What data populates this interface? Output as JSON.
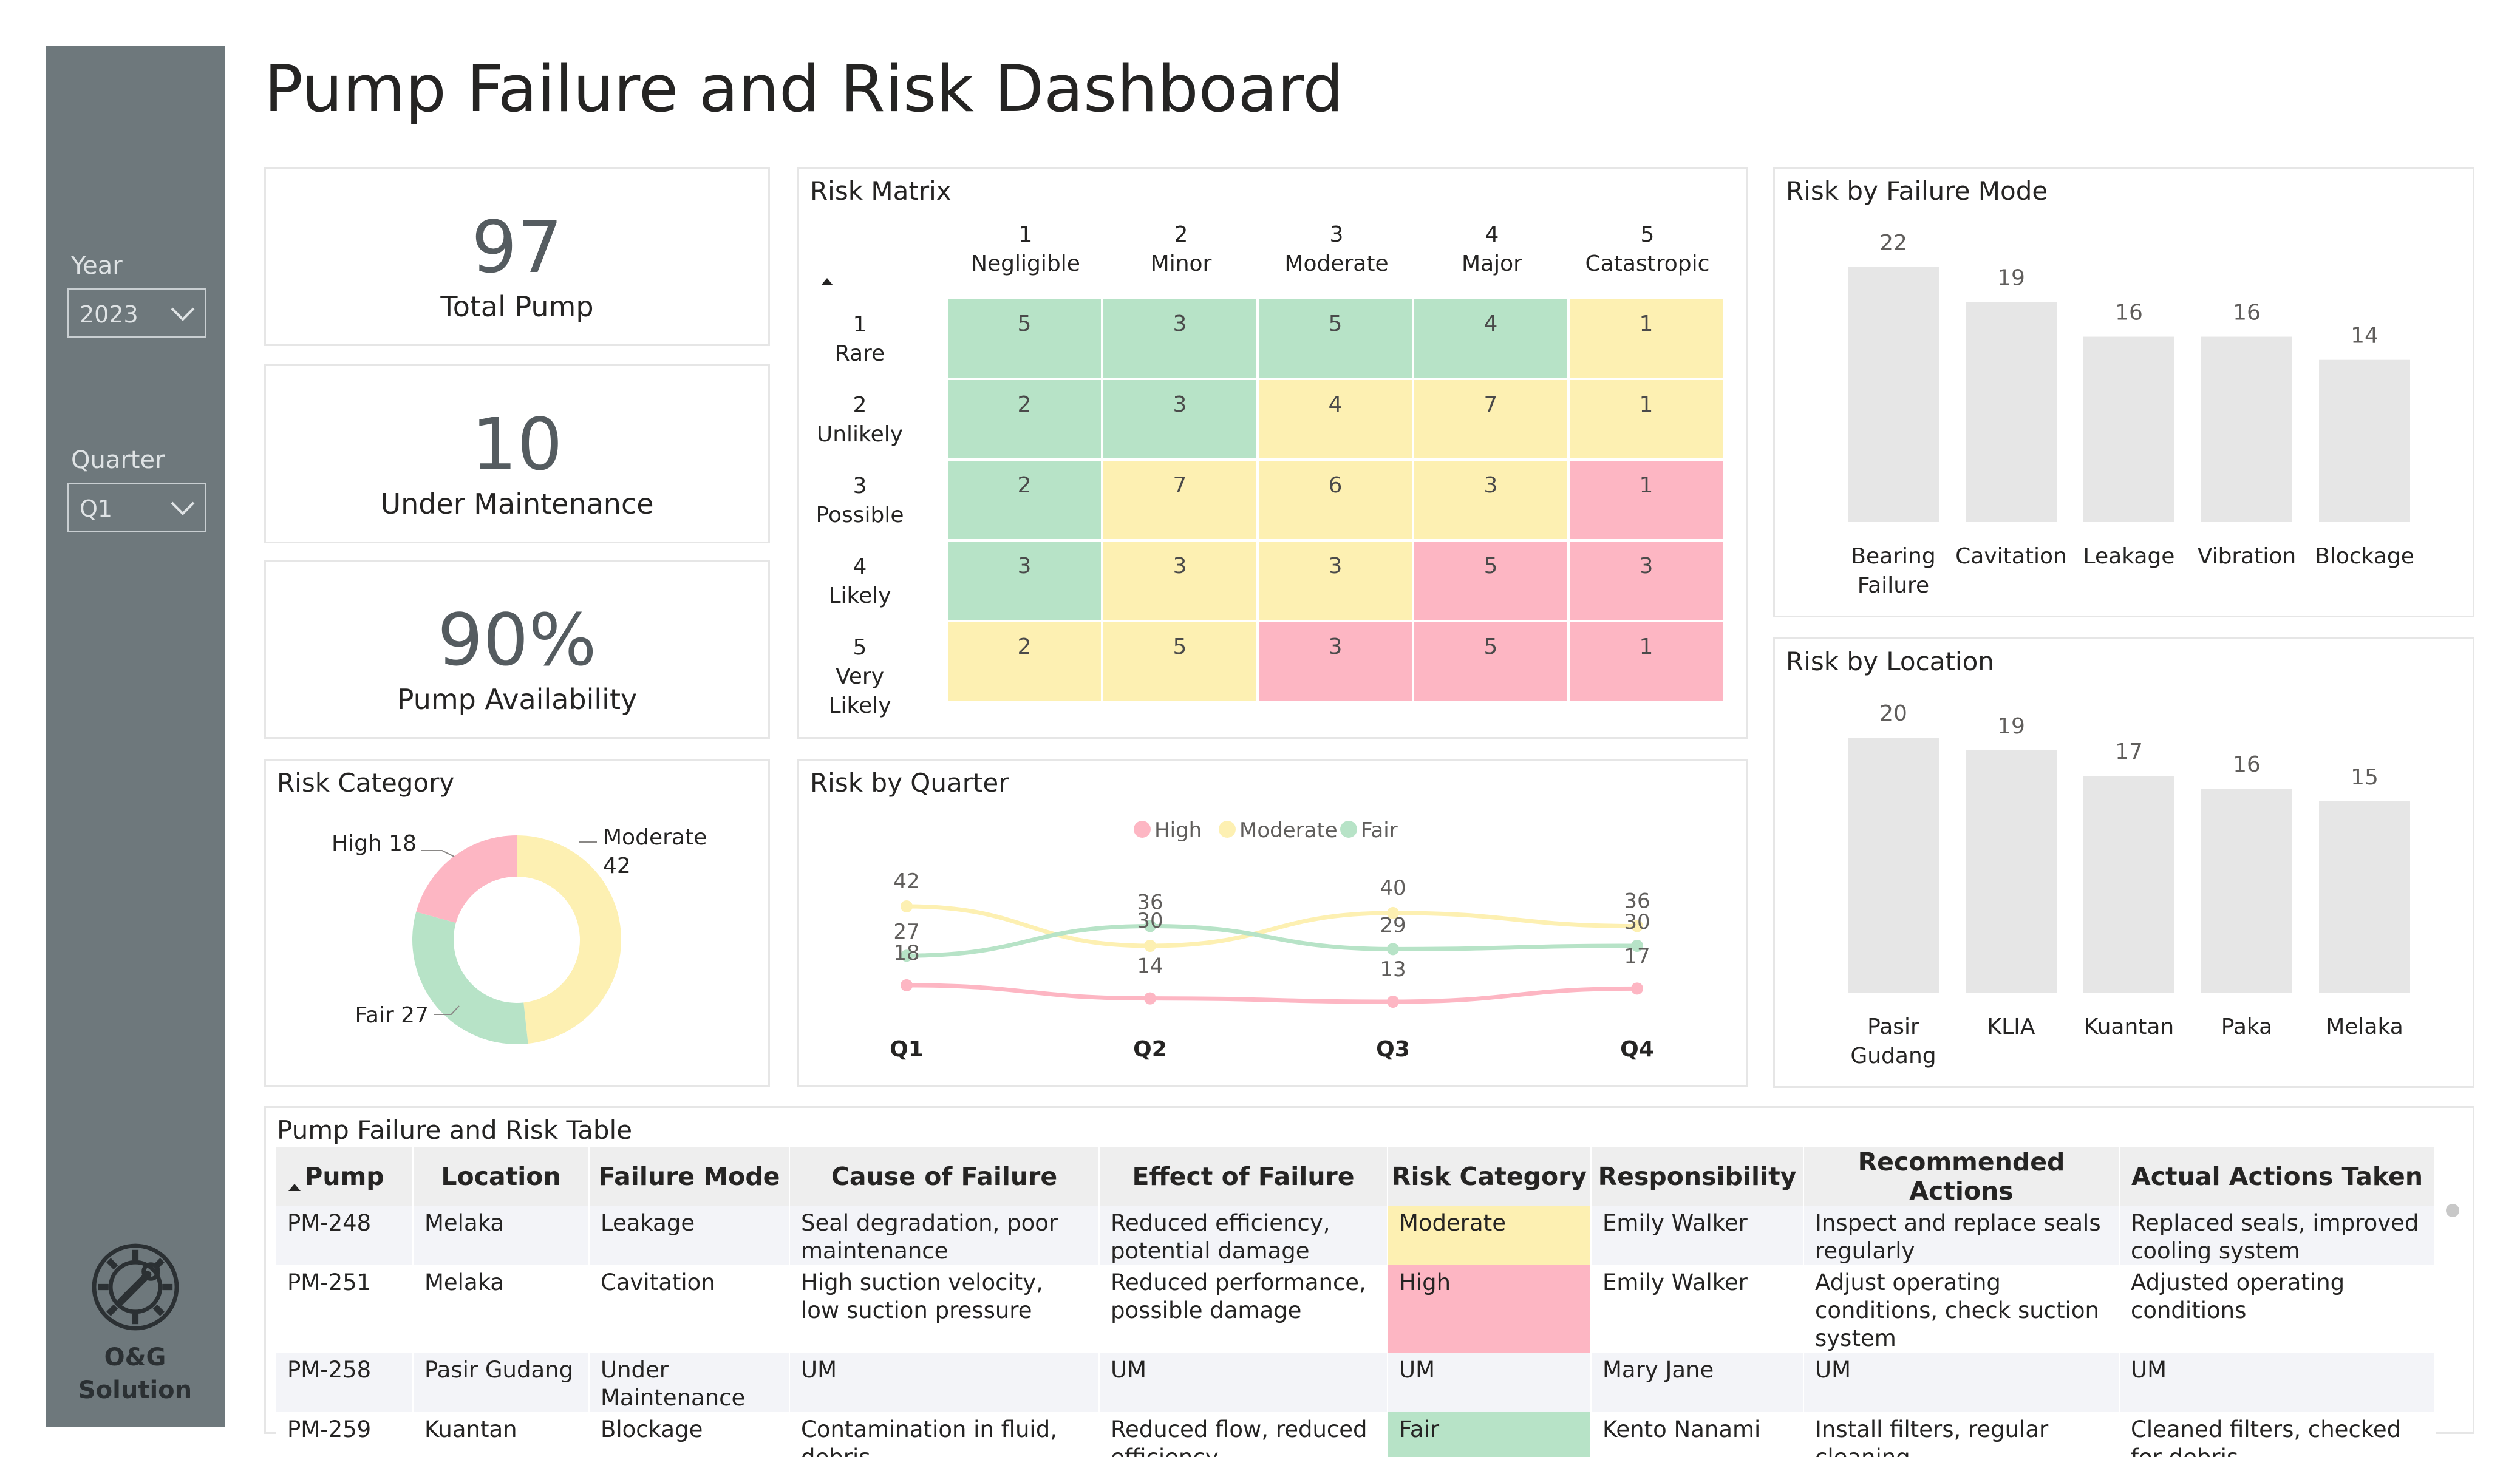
{
  "page": {
    "title": "Pump Failure and Risk Dashboard"
  },
  "sidebar": {
    "year_label": "Year",
    "year_value": "2023",
    "quarter_label": "Quarter",
    "quarter_value": "Q1",
    "brand_line1": "O&G",
    "brand_line2": "Solution",
    "brand_icon": "gear-wrench-icon"
  },
  "kpis": [
    {
      "value": "97",
      "label": "Total Pump"
    },
    {
      "value": "10",
      "label": "Under Maintenance"
    },
    {
      "value": "90%",
      "label": "Pump Availability"
    }
  ],
  "risk_matrix": {
    "title": "Risk Matrix",
    "columns": [
      {
        "num": "1",
        "name": "Negligible"
      },
      {
        "num": "2",
        "name": "Minor"
      },
      {
        "num": "3",
        "name": "Moderate"
      },
      {
        "num": "4",
        "name": "Major"
      },
      {
        "num": "5",
        "name": "Catastropic"
      }
    ],
    "rows": [
      {
        "num": "1",
        "name": "Rare",
        "cells": [
          {
            "v": "5",
            "c": "green"
          },
          {
            "v": "3",
            "c": "green"
          },
          {
            "v": "5",
            "c": "green"
          },
          {
            "v": "4",
            "c": "green"
          },
          {
            "v": "1",
            "c": "yellow"
          }
        ]
      },
      {
        "num": "2",
        "name": "Unlikely",
        "cells": [
          {
            "v": "2",
            "c": "green"
          },
          {
            "v": "3",
            "c": "green"
          },
          {
            "v": "4",
            "c": "yellow"
          },
          {
            "v": "7",
            "c": "yellow"
          },
          {
            "v": "1",
            "c": "yellow"
          }
        ]
      },
      {
        "num": "3",
        "name": "Possible",
        "cells": [
          {
            "v": "2",
            "c": "green"
          },
          {
            "v": "7",
            "c": "yellow"
          },
          {
            "v": "6",
            "c": "yellow"
          },
          {
            "v": "3",
            "c": "yellow"
          },
          {
            "v": "1",
            "c": "red"
          }
        ]
      },
      {
        "num": "4",
        "name": "Likely",
        "cells": [
          {
            "v": "3",
            "c": "green"
          },
          {
            "v": "3",
            "c": "yellow"
          },
          {
            "v": "3",
            "c": "yellow"
          },
          {
            "v": "5",
            "c": "red"
          },
          {
            "v": "3",
            "c": "red"
          }
        ]
      },
      {
        "num": "5",
        "name": "Very Likely",
        "cells": [
          {
            "v": "2",
            "c": "yellow"
          },
          {
            "v": "5",
            "c": "yellow"
          },
          {
            "v": "3",
            "c": "red"
          },
          {
            "v": "5",
            "c": "red"
          },
          {
            "v": "1",
            "c": "red"
          }
        ]
      }
    ]
  },
  "colors": {
    "high": "#fdb6c3",
    "moderate": "#fdf0b2",
    "fair": "#b7e3c7",
    "bar": "#e6e6e6",
    "sidebar": "#6e787c"
  },
  "chart_data": [
    {
      "id": "risk-category",
      "type": "pie",
      "title": "Risk Category",
      "categories": [
        "High",
        "Moderate",
        "Fair"
      ],
      "values": [
        18,
        42,
        27
      ],
      "labels": [
        "High 18",
        "Moderate",
        "42",
        "Fair 27"
      ]
    },
    {
      "id": "risk-by-quarter",
      "type": "line",
      "title": "Risk by Quarter",
      "x": [
        "Q1",
        "Q2",
        "Q3",
        "Q4"
      ],
      "series": [
        {
          "name": "High",
          "values": [
            18,
            14,
            13,
            17
          ]
        },
        {
          "name": "Moderate",
          "values": [
            42,
            30,
            40,
            36
          ]
        },
        {
          "name": "Fair",
          "values": [
            27,
            36,
            29,
            30
          ]
        }
      ],
      "legend": "top-center"
    },
    {
      "id": "risk-by-failure-mode",
      "type": "bar",
      "title": "Risk by Failure Mode",
      "categories": [
        "Bearing\nFailure",
        "Cavitation",
        "Leakage",
        "Vibration",
        "Blockage"
      ],
      "values": [
        22,
        19,
        16,
        16,
        14
      ]
    },
    {
      "id": "risk-by-location",
      "type": "bar",
      "title": "Risk by Location",
      "categories": [
        "Pasir\nGudang",
        "KLIA",
        "Kuantan",
        "Paka",
        "Melaka"
      ],
      "values": [
        20,
        19,
        17,
        16,
        15
      ]
    }
  ],
  "table": {
    "title": "Pump Failure and Risk Table",
    "columns": [
      "Pump",
      "Location",
      "Failure Mode",
      "Cause of Failure",
      "Effect of Failure",
      "Risk Category",
      "Responsibility",
      "Recommended Actions",
      "Actual Actions Taken"
    ],
    "rows": [
      [
        "PM-248",
        "Melaka",
        "Leakage",
        "Seal degradation, poor maintenance",
        "Reduced efficiency, potential damage",
        "Moderate",
        "Emily Walker",
        "Inspect and replace seals regularly",
        "Replaced seals, improved cooling system"
      ],
      [
        "PM-251",
        "Melaka",
        "Cavitation",
        "High suction velocity, low suction pressure",
        "Reduced performance, possible damage",
        "High",
        "Emily Walker",
        "Adjust operating conditions, check suction system",
        "Adjusted operating conditions"
      ],
      [
        "PM-258",
        "Pasir Gudang",
        "Under Maintenance",
        "UM",
        "UM",
        "UM",
        "Mary Jane",
        "UM",
        "UM"
      ],
      [
        "PM-259",
        "Kuantan",
        "Blockage",
        "Contamination in fluid, debris",
        "Reduced flow, reduced efficiency",
        "Fair",
        "Kento Nanami",
        "Install filters, regular cleaning",
        "Cleaned filters, checked for debris"
      ]
    ]
  }
}
